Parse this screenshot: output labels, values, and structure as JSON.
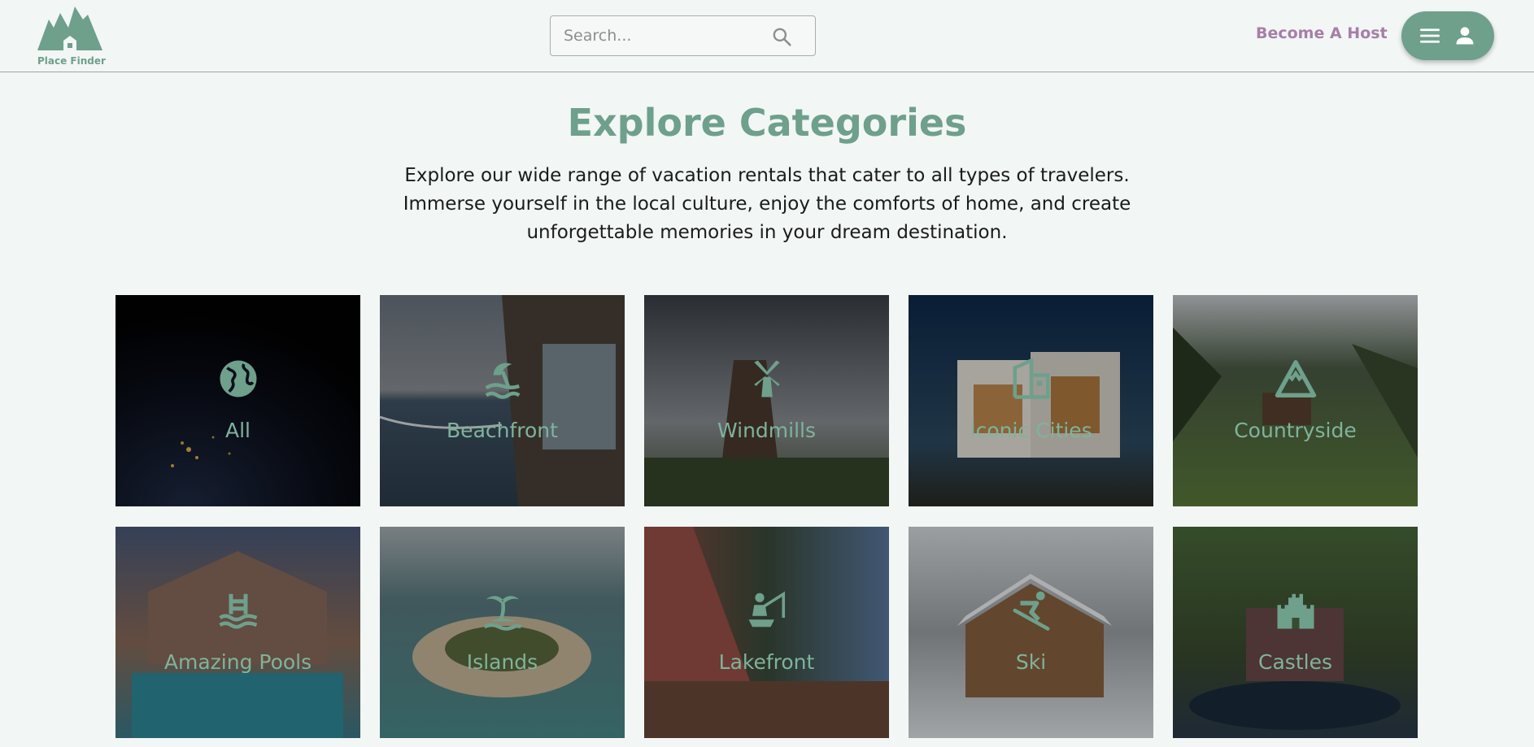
{
  "header": {
    "logo_text": "Place Finder",
    "search_placeholder": "Search...",
    "host_link": "Become A Host",
    "brand_color": "#6ea08c",
    "host_color": "#a77ea8"
  },
  "hero": {
    "title": "Explore Categories",
    "description": "Explore our wide range of vacation rentals that cater to all types of travelers. Immerse yourself in the local culture, enjoy the comforts of home, and create unforgettable memories in your dream destination."
  },
  "categories": [
    {
      "label": "All",
      "icon": "globe-icon"
    },
    {
      "label": "Beachfront",
      "icon": "umbrella-beach-icon"
    },
    {
      "label": "Windmills",
      "icon": "windmill-icon"
    },
    {
      "label": "Iconic Cities",
      "icon": "city-building-icon"
    },
    {
      "label": "Countryside",
      "icon": "mountain-icon"
    },
    {
      "label": "Amazing Pools",
      "icon": "pool-icon"
    },
    {
      "label": "Islands",
      "icon": "island-palm-icon"
    },
    {
      "label": "Lakefront",
      "icon": "fishing-icon"
    },
    {
      "label": "Ski",
      "icon": "skiing-icon"
    },
    {
      "label": "Castles",
      "icon": "castle-icon"
    }
  ]
}
